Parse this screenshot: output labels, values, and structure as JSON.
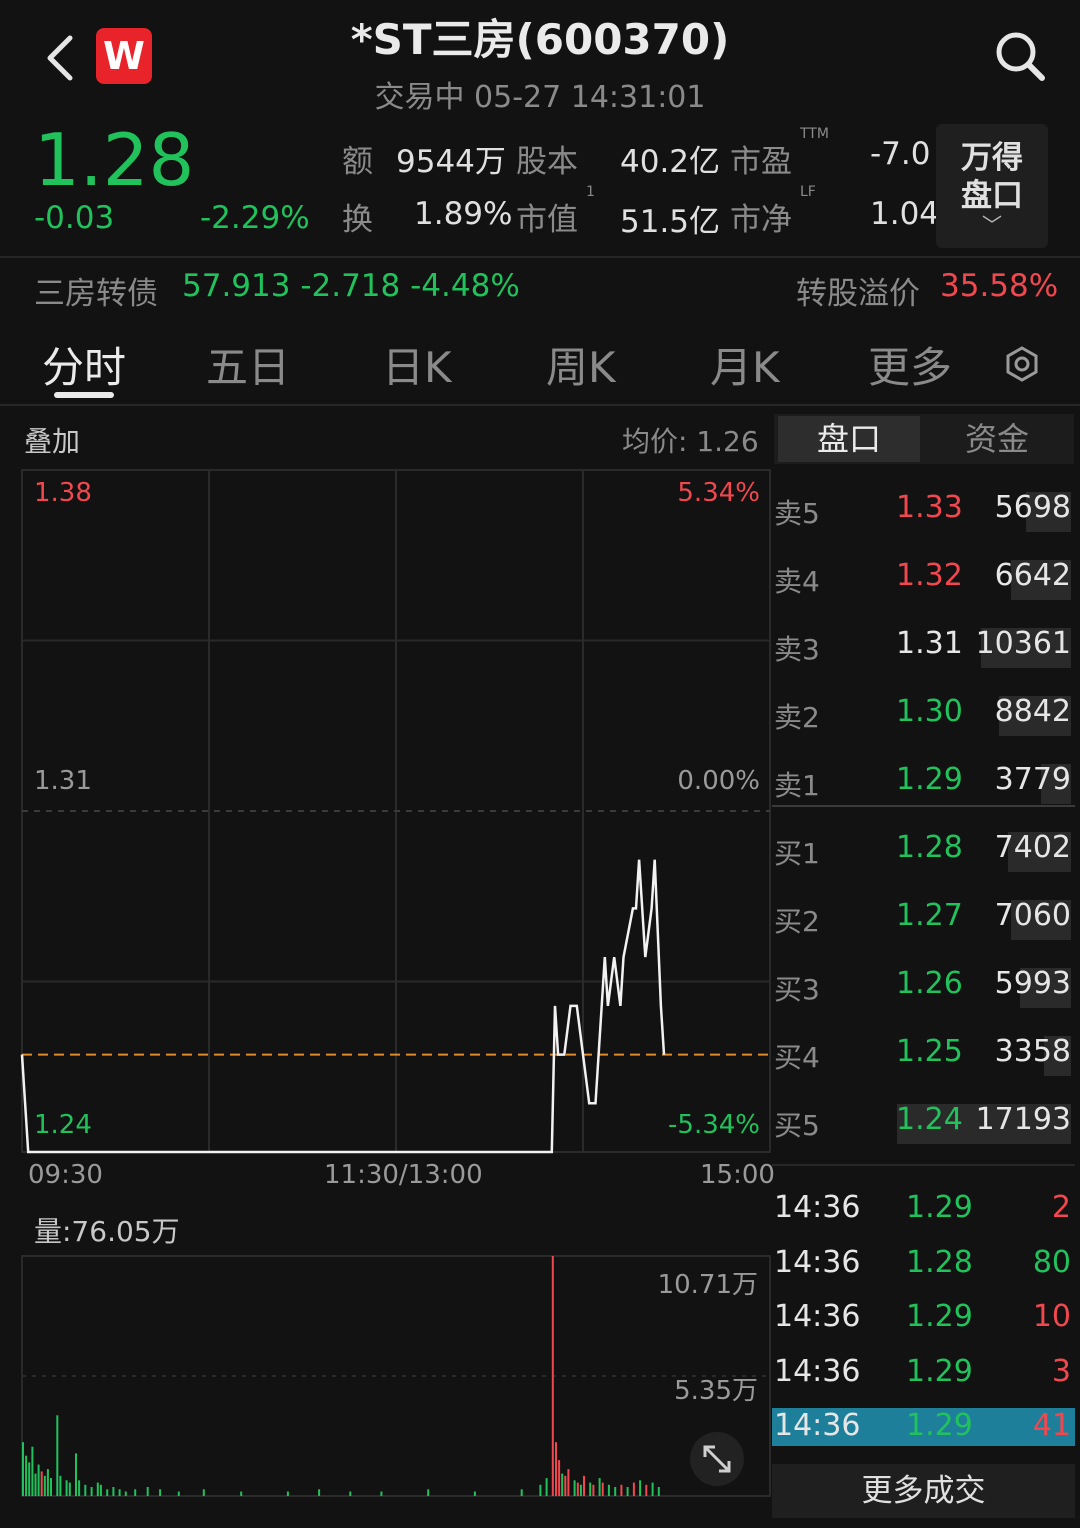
{
  "header": {
    "title": "*ST三房(600370)",
    "status": "交易中 05-27 14:31:01",
    "logo_letter": "W"
  },
  "quote": {
    "price": "1.28",
    "change": "-0.03",
    "change_pct": "-2.29%",
    "stats": {
      "amount_label": "额",
      "amount": "9544万",
      "share_cap_label": "股本",
      "share_cap": "40.2亿",
      "pe_label": "市盈",
      "pe_sup": "TTM",
      "pe": "-7.0",
      "turnover_label": "换",
      "turnover": "1.89%",
      "mktcap_label": "市值",
      "mktcap_sup": "1",
      "mktcap": "51.5亿",
      "pb_label": "市净",
      "pb_sup": "LF",
      "pb": "1.04"
    },
    "wdpk": {
      "line1": "万得",
      "line2": "盘口",
      "chevron": "﹀"
    }
  },
  "bond": {
    "name": "三房转债",
    "values": "57.913 -2.718 -4.48%",
    "premium_label": "转股溢价",
    "premium": "35.58%"
  },
  "tabs": [
    "分时",
    "五日",
    "日K",
    "周K",
    "月K",
    "更多"
  ],
  "chart_header": {
    "overlay": "叠加",
    "avg_price": "均价:  1.26",
    "seg_a": "盘口",
    "seg_b": "资金"
  },
  "chart_data": {
    "type": "line",
    "price_labels": {
      "top": "1.38",
      "mid": "1.31",
      "bottom": "1.24"
    },
    "pct_labels": {
      "top": "5.34%",
      "mid": "0.00%",
      "bottom": "-5.34%"
    },
    "x_labels": [
      "09:30",
      "11:30/13:00",
      "15:00"
    ],
    "ylim": [
      1.24,
      1.38
    ],
    "avg_price": 1.26,
    "price_series": [
      [
        0,
        1.26
      ],
      [
        1,
        1.25
      ],
      [
        2,
        1.24
      ],
      [
        4,
        1.24
      ],
      [
        5,
        1.24
      ],
      [
        6,
        1.24
      ],
      [
        7,
        1.24
      ],
      [
        8,
        1.24
      ],
      [
        10,
        1.24
      ],
      [
        12,
        1.24
      ],
      [
        15,
        1.24
      ],
      [
        20,
        1.24
      ],
      [
        25,
        1.24
      ],
      [
        28,
        1.24
      ],
      [
        30,
        1.24
      ],
      [
        40,
        1.24
      ],
      [
        60,
        1.24
      ],
      [
        80,
        1.24
      ],
      [
        100,
        1.24
      ],
      [
        120,
        1.24
      ],
      [
        150,
        1.24
      ],
      [
        170,
        1.24
      ],
      [
        171,
        1.27
      ],
      [
        172,
        1.26
      ],
      [
        173,
        1.26
      ],
      [
        174,
        1.26
      ],
      [
        176,
        1.27
      ],
      [
        178,
        1.27
      ],
      [
        180,
        1.26
      ],
      [
        182,
        1.25
      ],
      [
        184,
        1.25
      ],
      [
        185,
        1.26
      ],
      [
        186,
        1.27
      ],
      [
        187,
        1.28
      ],
      [
        188,
        1.27
      ],
      [
        190,
        1.28
      ],
      [
        192,
        1.27
      ],
      [
        193,
        1.28
      ],
      [
        196,
        1.29
      ],
      [
        197,
        1.29
      ],
      [
        198,
        1.3
      ],
      [
        200,
        1.28
      ],
      [
        202,
        1.29
      ],
      [
        203,
        1.3
      ],
      [
        205,
        1.27
      ],
      [
        206,
        1.26
      ]
    ],
    "volume": {
      "title": "量:76.05万",
      "max_label": "10.71万",
      "mid_label": "5.35万",
      "ylim": [
        0,
        10.71
      ],
      "unit": "万",
      "bars": [
        [
          0,
          2.4,
          "g"
        ],
        [
          1,
          1.8,
          "g"
        ],
        [
          2,
          1.5,
          "g"
        ],
        [
          3,
          2.2,
          "g"
        ],
        [
          4,
          1.0,
          "g"
        ],
        [
          5,
          1.4,
          "g"
        ],
        [
          6,
          1.1,
          "r"
        ],
        [
          7,
          0.9,
          "g"
        ],
        [
          8,
          1.2,
          "g"
        ],
        [
          9,
          0.8,
          "g"
        ],
        [
          11,
          3.6,
          "g"
        ],
        [
          12,
          0.9,
          "g"
        ],
        [
          14,
          0.7,
          "g"
        ],
        [
          15,
          0.6,
          "g"
        ],
        [
          17,
          1.9,
          "g"
        ],
        [
          18,
          0.7,
          "g"
        ],
        [
          20,
          0.5,
          "g"
        ],
        [
          22,
          0.4,
          "g"
        ],
        [
          24,
          0.6,
          "g"
        ],
        [
          25,
          0.5,
          "g"
        ],
        [
          27,
          0.3,
          "g"
        ],
        [
          29,
          0.4,
          "g"
        ],
        [
          31,
          0.3,
          "g"
        ],
        [
          33,
          0.2,
          "g"
        ],
        [
          36,
          0.3,
          "g"
        ],
        [
          40,
          0.4,
          "g"
        ],
        [
          44,
          0.3,
          "g"
        ],
        [
          50,
          0.2,
          "g"
        ],
        [
          58,
          0.3,
          "g"
        ],
        [
          70,
          0.2,
          "g"
        ],
        [
          85,
          0.2,
          "g"
        ],
        [
          95,
          0.3,
          "g"
        ],
        [
          105,
          0.2,
          "g"
        ],
        [
          115,
          0.2,
          "g"
        ],
        [
          130,
          0.3,
          "g"
        ],
        [
          145,
          0.2,
          "g"
        ],
        [
          160,
          0.3,
          "g"
        ],
        [
          166,
          0.5,
          "g"
        ],
        [
          168,
          0.8,
          "g"
        ],
        [
          170,
          10.71,
          "r"
        ],
        [
          171,
          2.4,
          "r"
        ],
        [
          172,
          1.6,
          "r"
        ],
        [
          173,
          1.0,
          "g"
        ],
        [
          174,
          0.9,
          "r"
        ],
        [
          175,
          1.2,
          "r"
        ],
        [
          177,
          0.7,
          "g"
        ],
        [
          178,
          0.6,
          "r"
        ],
        [
          179,
          0.5,
          "g"
        ],
        [
          180,
          0.9,
          "r"
        ],
        [
          182,
          0.6,
          "g"
        ],
        [
          183,
          0.5,
          "r"
        ],
        [
          185,
          0.8,
          "g"
        ],
        [
          186,
          0.6,
          "r"
        ],
        [
          188,
          0.5,
          "g"
        ],
        [
          190,
          0.4,
          "g"
        ],
        [
          192,
          0.5,
          "r"
        ],
        [
          194,
          0.4,
          "g"
        ],
        [
          196,
          0.6,
          "r"
        ],
        [
          198,
          0.7,
          "g"
        ],
        [
          200,
          0.5,
          "r"
        ],
        [
          202,
          0.6,
          "g"
        ],
        [
          204,
          0.4,
          "g"
        ]
      ]
    }
  },
  "order_book": {
    "asks": [
      {
        "label": "卖5",
        "price": "1.33",
        "vol": "5698",
        "color": "red",
        "bar": 0.15
      },
      {
        "label": "卖4",
        "price": "1.32",
        "vol": "6642",
        "color": "red",
        "bar": 0.2
      },
      {
        "label": "卖3",
        "price": "1.31",
        "vol": "10361",
        "color": "white",
        "bar": 0.3
      },
      {
        "label": "卖2",
        "price": "1.30",
        "vol": "8842",
        "color": "green",
        "bar": 0.24
      },
      {
        "label": "卖1",
        "price": "1.29",
        "vol": "3779",
        "color": "green",
        "bar": 0.1
      }
    ],
    "bids": [
      {
        "label": "买1",
        "price": "1.28",
        "vol": "7402",
        "color": "green",
        "bar": 0.21
      },
      {
        "label": "买2",
        "price": "1.27",
        "vol": "7060",
        "color": "green",
        "bar": 0.2
      },
      {
        "label": "买3",
        "price": "1.26",
        "vol": "5993",
        "color": "green",
        "bar": 0.17
      },
      {
        "label": "买4",
        "price": "1.25",
        "vol": "3358",
        "color": "green",
        "bar": 0.09
      },
      {
        "label": "买5",
        "price": "1.24",
        "vol": "17193",
        "color": "green",
        "bar": 0.58
      }
    ]
  },
  "trades": {
    "rows": [
      {
        "time": "14:36",
        "price": "1.29",
        "vol": "2",
        "color": "red"
      },
      {
        "time": "14:36",
        "price": "1.28",
        "vol": "80",
        "color": "green"
      },
      {
        "time": "14:36",
        "price": "1.29",
        "vol": "10",
        "color": "red"
      },
      {
        "time": "14:36",
        "price": "1.29",
        "vol": "3",
        "color": "red"
      },
      {
        "time": "14:36",
        "price": "1.29",
        "vol": "41",
        "color": "red"
      }
    ],
    "more_label": "更多成交"
  }
}
